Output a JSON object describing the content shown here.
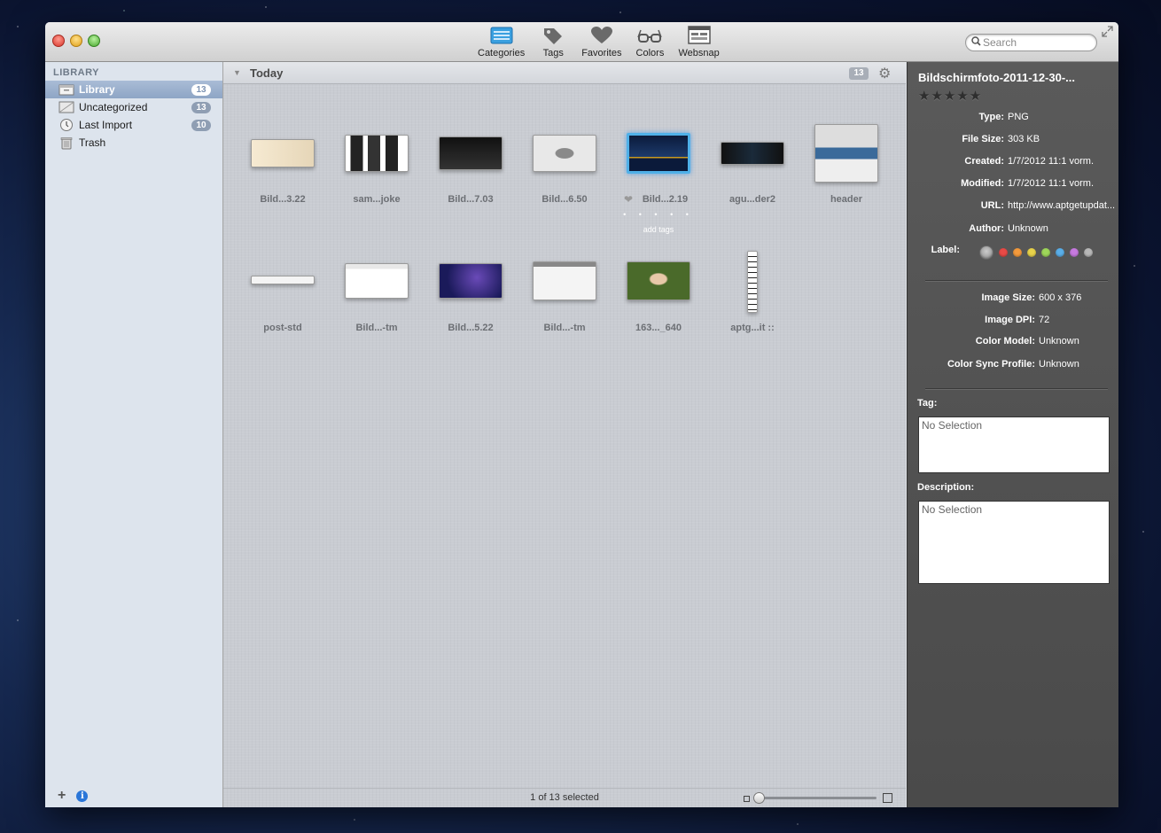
{
  "toolbar": {
    "buttons": [
      {
        "label": "Categories",
        "icon": "categories-icon"
      },
      {
        "label": "Tags",
        "icon": "tags-icon"
      },
      {
        "label": "Favorites",
        "icon": "heart-icon"
      },
      {
        "label": "Colors",
        "icon": "glasses-icon"
      },
      {
        "label": "Websnap",
        "icon": "websnap-icon"
      }
    ],
    "search_placeholder": "Search"
  },
  "sidebar": {
    "heading": "LIBRARY",
    "items": [
      {
        "label": "Library",
        "count": "13",
        "selected": true
      },
      {
        "label": "Uncategorized",
        "count": "13"
      },
      {
        "label": "Last Import",
        "count": "10"
      },
      {
        "label": "Trash",
        "count": ""
      }
    ]
  },
  "main": {
    "group_title": "Today",
    "group_count": "13",
    "thumbnails": [
      {
        "label": "Bild...3.22"
      },
      {
        "label": "sam...joke"
      },
      {
        "label": "Bild...7.03"
      },
      {
        "label": "Bild...6.50"
      },
      {
        "label": "Bild...2.19",
        "selected": true
      },
      {
        "label": "agu...der2"
      },
      {
        "label": "header"
      },
      {
        "label": "post-std"
      },
      {
        "label": "Bild...-tm"
      },
      {
        "label": "Bild...5.22"
      },
      {
        "label": "Bild...-tm"
      },
      {
        "label": "163..._640"
      },
      {
        "label": "aptg...it ::"
      }
    ],
    "selected_dots": "• • • • •",
    "add_tags": "add tags",
    "status": "1 of 13 selected"
  },
  "inspector": {
    "title": "Bildschirmfoto-2011-12-30-...",
    "rating": "★★★★★",
    "fields": [
      {
        "key": "Type:",
        "value": "PNG"
      },
      {
        "key": "File Size:",
        "value": "303 KB"
      },
      {
        "key": "Created:",
        "value": "1/7/2012 11:1 vorm."
      },
      {
        "key": "Modified:",
        "value": "1/7/2012 11:1 vorm."
      },
      {
        "key": "URL:",
        "value": "http://www.aptgetupdat..."
      },
      {
        "key": "Author:",
        "value": "Unknown"
      }
    ],
    "label_key": "Label:",
    "label_colors": [
      "#e84a46",
      "#f39a3c",
      "#e8d24a",
      "#9ed65a",
      "#5aaee8",
      "#c77ae0",
      "#b8b8b8"
    ],
    "image_fields": [
      {
        "key": "Image Size:",
        "value": "600 x 376"
      },
      {
        "key": "Image DPI:",
        "value": "72"
      },
      {
        "key": "Color Model:",
        "value": "Unknown"
      },
      {
        "key": "Color Sync Profile:",
        "value": "Unknown"
      }
    ],
    "tag_label": "Tag:",
    "tag_value": "No Selection",
    "description_label": "Description:",
    "description_value": "No Selection"
  }
}
